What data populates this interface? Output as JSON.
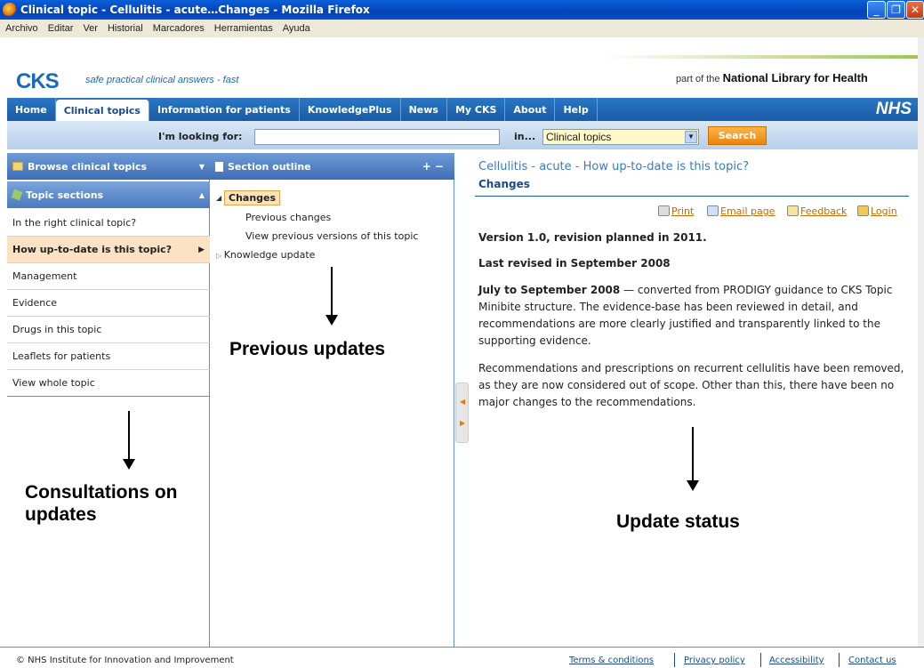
{
  "window": {
    "title": "Clinical topic - Cellulitis - acute…Changes - Mozilla Firefox"
  },
  "menu": [
    "Archivo",
    "Editar",
    "Ver",
    "Historial",
    "Marcadores",
    "Herramientas",
    "Ayuda"
  ],
  "header": {
    "logo": "CKS",
    "tagline": "safe practical clinical answers - fast",
    "nlh_prefix": "part of the ",
    "nlh_name": "National Library for Health"
  },
  "nav": {
    "tabs": [
      "Home",
      "Clinical topics",
      "Information for patients",
      "KnowledgePlus",
      "News",
      "My CKS",
      "About",
      "Help"
    ],
    "active": 1,
    "brand": "NHS"
  },
  "search": {
    "label": "I'm looking for:",
    "value": "",
    "in_label": "in...",
    "scope": "Clinical topics",
    "button": "Search"
  },
  "left": {
    "browse": "Browse clinical topics",
    "sections_title": "Topic sections",
    "items": [
      "In the right clinical topic?",
      "How up-to-date is this topic?",
      "Management",
      "Evidence",
      "Drugs in this topic",
      "Leaflets for patients",
      "View whole topic"
    ],
    "active": 1
  },
  "outline": {
    "title": "Section outline",
    "controls": "+ −",
    "current": "Changes",
    "children": [
      "Previous changes",
      "View previous versions of this topic"
    ],
    "other": "Knowledge update"
  },
  "main": {
    "title": "Cellulitis - acute - How up-to-date is this topic?",
    "subtitle": "Changes",
    "tools": [
      "Print",
      "Email page",
      "Feedback",
      "Login"
    ],
    "version": "Version 1.0, revision planned in 2011.",
    "revised": "Last revised in September 2008",
    "para1_bold": "July to September 2008",
    "para1": " — converted from PRODIGY guidance to CKS Topic Minibite structure. The evidence-base has been reviewed in detail, and recommendations are more clearly justified and transparently linked to the supporting evidence.",
    "para2": "Recommendations and prescriptions on recurrent cellulitis have been removed, as they are now considered out of scope. Other than this, there have been no major changes to the recommendations."
  },
  "annotations": {
    "left": "Consultations on updates",
    "middle": "Previous updates",
    "right": "Update status"
  },
  "footer": {
    "copyright": "© NHS Institute for Innovation and Improvement",
    "links": [
      "Terms & conditions",
      "Privacy policy",
      "Accessibility",
      "Contact us"
    ]
  }
}
